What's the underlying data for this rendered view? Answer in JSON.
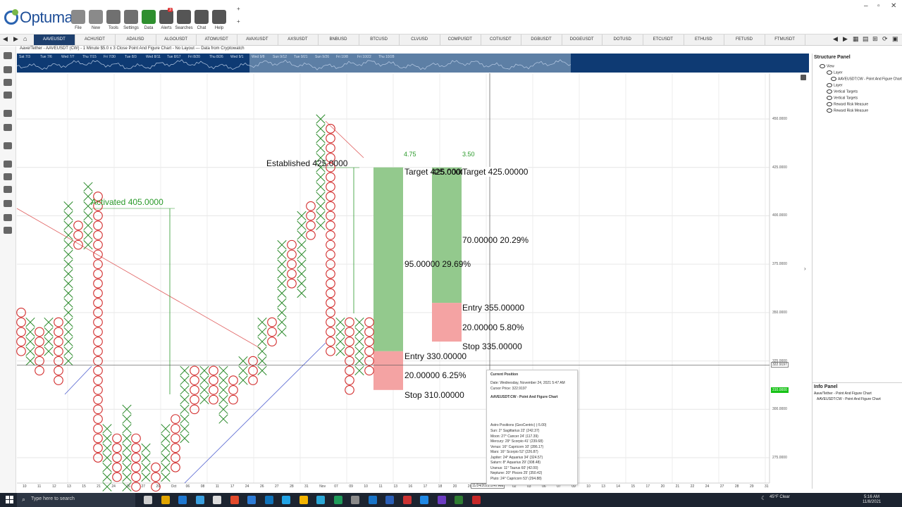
{
  "app": {
    "logo_text": "Optuma",
    "window_controls": [
      "–",
      "▫",
      "✕"
    ],
    "add_buttons": [
      "+",
      "+"
    ]
  },
  "toolbar": {
    "buttons": [
      {
        "label": "File",
        "icon": "folder-icon"
      },
      {
        "label": "New",
        "icon": "new-document-icon"
      },
      {
        "label": "Tools",
        "icon": "tools-icon"
      },
      {
        "label": "Settings",
        "icon": "gear-icon"
      },
      {
        "label": "Data",
        "icon": "binary-data-icon"
      },
      {
        "label": "Alerts",
        "icon": "alarm-clock-icon",
        "badge": "3"
      },
      {
        "label": "Searches",
        "icon": "search-icon"
      },
      {
        "label": "Chat",
        "icon": "chat-bubbles-icon"
      },
      {
        "label": "Help",
        "icon": "help-icon"
      }
    ]
  },
  "symbol_tabs": [
    "AAVEUSDT",
    "ACHUSDT",
    "ADAUSD",
    "ALGOUSDT",
    "ATOMUSDT",
    "AVAXUSDT",
    "AXSUSDT",
    "BNBUSD",
    "BTCUSD",
    "CLVUSD",
    "COMPUSDT",
    "COTIUSDT",
    "DGBUSDT",
    "DOGEUSDT",
    "DOTUSD",
    "ETCUSDT",
    "ETHUSD",
    "FETUSD",
    "FTMUSDT"
  ],
  "active_symbol": "AAVEUSDT",
  "chart_title": "Aave/Tether - AAVEUSDT (CW) - 1 Minute $5.0 x 3 Close Point And Figure Chart - No Layout --- Data from Cryptowatch",
  "overview_labels": [
    "Sat 7/3",
    "Tue 7/6",
    "Wed 7/7",
    "Thu 7/15",
    "Fri 7/30",
    "Tue 8/3",
    "Wed 8/11",
    "Tue 8/17",
    "Fri 8/20",
    "Thu 8/26",
    "Wed 9/1",
    "Wed 9/8",
    "Sun 9/12",
    "Tue 9/21",
    "Sun 9/26",
    "Fri 10/8",
    "Fri 10/22",
    "Thu 10/28"
  ],
  "price_axis": [
    "450.0000",
    "425.0000",
    "400.0000",
    "375.0000",
    "350.0000",
    "325.0000",
    "300.0000",
    "275.0000"
  ],
  "cursor_price_tag": "322.9197",
  "last_price_tag": "310.0000",
  "date_axis": [
    "10",
    "11",
    "12",
    "13",
    "15",
    "21",
    "24",
    "26",
    "27",
    "29",
    "Oct",
    "06",
    "08",
    "11",
    "17",
    "24",
    "26",
    "27",
    "28",
    "31",
    "Nov",
    "07",
    "09",
    "10",
    "11",
    "13",
    "16",
    "17",
    "18",
    "20",
    "26",
    "29",
    "Dec",
    "02",
    "03",
    "06",
    "07",
    "09",
    "10",
    "13",
    "14",
    "15",
    "17",
    "20",
    "21",
    "22",
    "24",
    "27",
    "28",
    "29",
    "31"
  ],
  "cursor_date_tag": "11/24/2021 5:47 AM",
  "annotations": {
    "activated": "Activated 405.0000",
    "established": "Established 425.0000"
  },
  "rr1": {
    "ratio": "4.75",
    "target": "Target   425.00000",
    "reward": "95.00000   29.69%",
    "entry": "Entry   330.00000",
    "risk": "20.00000   6.25%",
    "stop": "Stop   310.00000"
  },
  "rr2": {
    "ratio": "3.50",
    "target": "Target   425.00000",
    "reward": "70.00000   20.29%",
    "entry": "Entry   355.00000",
    "risk": "20.00000   5.80%",
    "stop": "Stop   335.00000"
  },
  "tooltip": {
    "title": "Current Position",
    "date": "Date: Wednesday, November 24, 2021 5:47 AM",
    "cursor_price": "Cursor Price: 322.9197",
    "chart_name": "AAVEUSDT:CW - Point And Figure Chart",
    "astro_header": "Astro Positions (GeoCentric) (-5.00)",
    "astro": [
      "Sun: 2° Sagittarius 22' (242.37)",
      "Moon: 27° Cancer 24' (117.39)",
      "Mercury: 29° Scorpio 41' (239.68)",
      "Venus: 16° Capricorn 10' (286.17)",
      "Mars: 16° Scorpio 52' (226.87)",
      "Jupiter: 24° Aquarius 34' (324.57)",
      "Saturn: 8° Aquarius 29' (308.48)",
      "Uranus: 11° Taurus 60' (42.00)",
      "Neptune: 20° Pisces 25' (350.42)",
      "Pluto: 24° Capricorn 53' (294.88)"
    ]
  },
  "structure_panel": {
    "title": "Structure Panel",
    "items": [
      "View",
      "Layer",
      "AAVEUSDT:CW - Point And Figure Chart",
      "Layer",
      "Vertical Targets",
      "Vertical Targets",
      "Reward Risk Measure",
      "Reward Risk Measure"
    ]
  },
  "info_panel": {
    "title": "Info Panel",
    "items": [
      "Aave/Tether - Point And Figure Chart",
      "AAVEUSDT:CW - Point And Figure Chart"
    ]
  },
  "taskbar": {
    "search_placeholder": "Type here to search",
    "weather": "45°F  Clear",
    "time": "5:16 AM",
    "date": "11/8/2021"
  },
  "colors": {
    "x_mark": "#2a8a2a",
    "o_mark": "#d22b2b",
    "reward_zone": "#93c98d",
    "risk_zone": "#f4a3a3",
    "overview_bg": "#0e3a73",
    "active_tab": "#1d3f6e"
  }
}
